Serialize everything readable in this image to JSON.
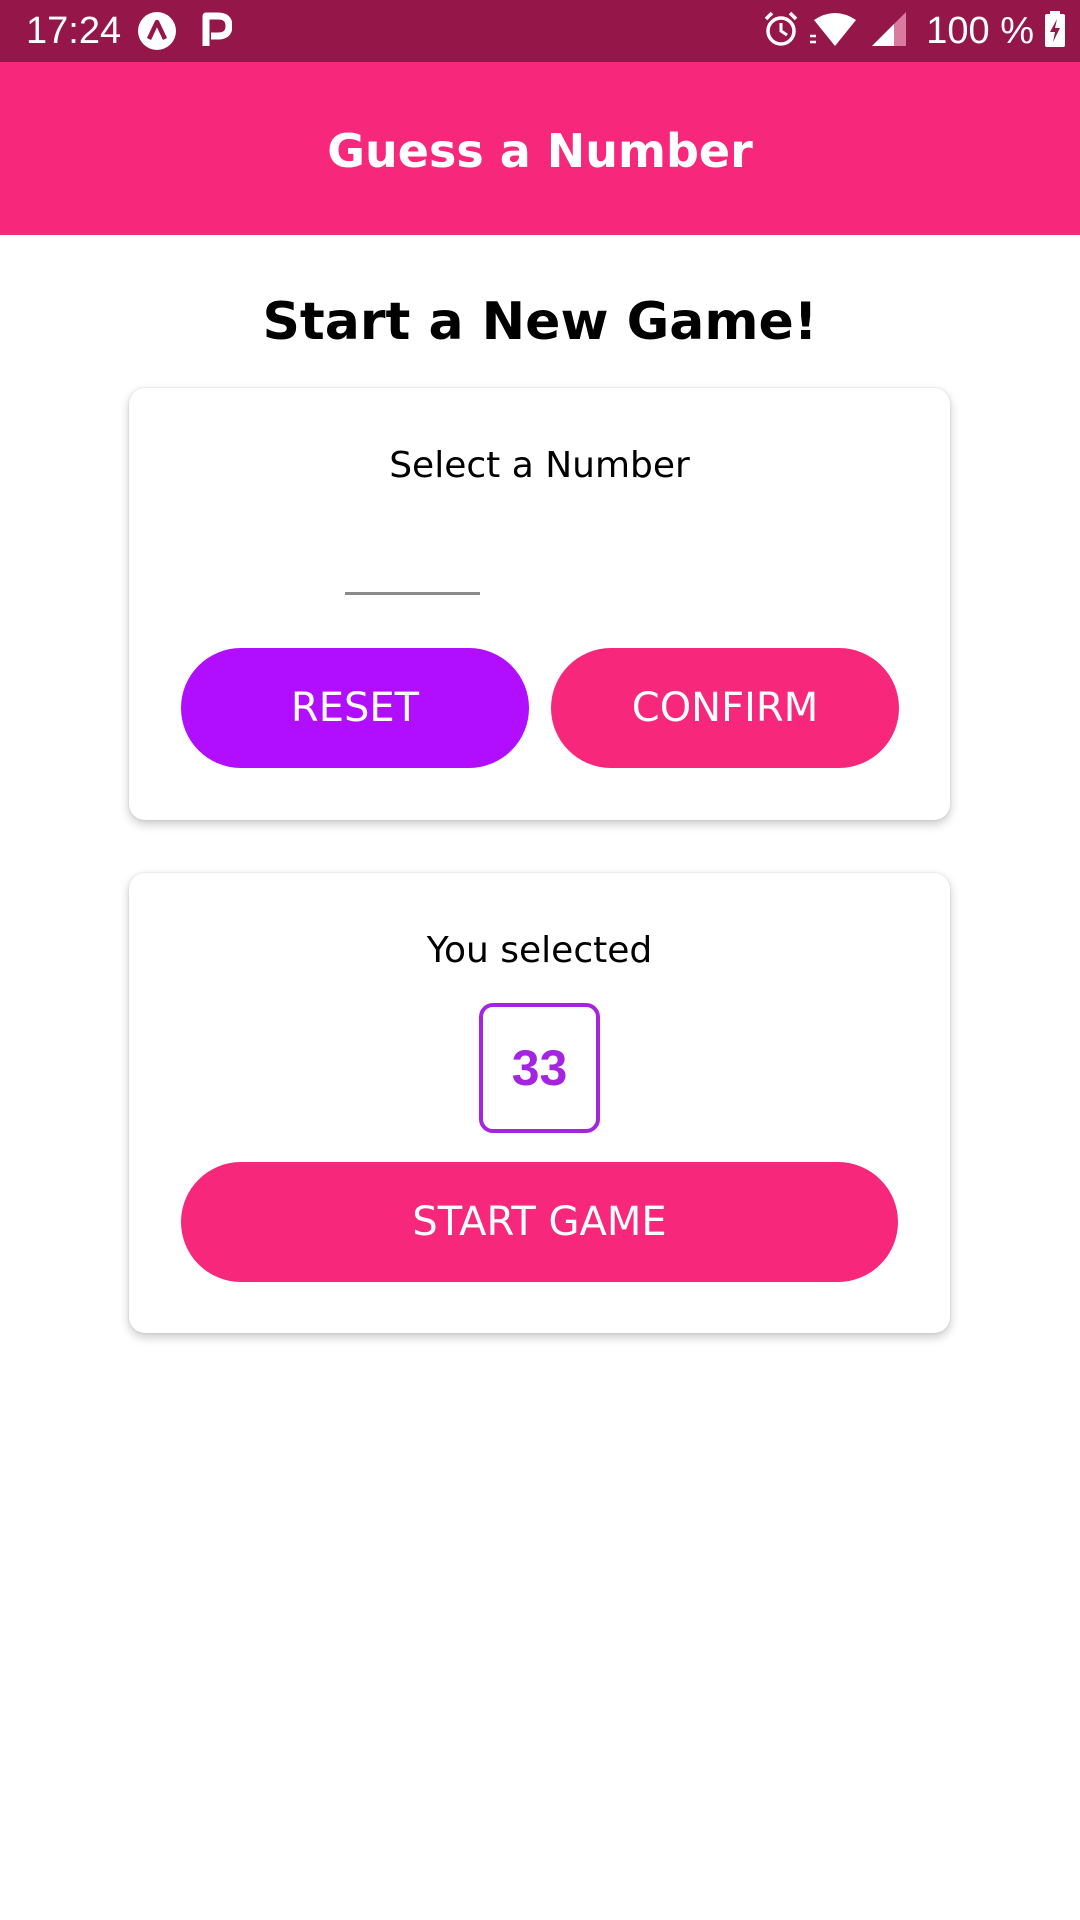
{
  "status_bar": {
    "time": "17:24",
    "battery_text": "100 %",
    "icons": [
      "app-a-icon",
      "p-icon",
      "alarm-icon",
      "wifi-icon",
      "signal-icon",
      "battery-charging-icon"
    ]
  },
  "header": {
    "title": "Guess a Number"
  },
  "screen": {
    "title": "Start a New Game!"
  },
  "input_card": {
    "label": "Select a Number",
    "input_value": "",
    "reset_label": "RESET",
    "confirm_label": "CONFIRM"
  },
  "summary_card": {
    "label": "You selected",
    "selected_number": "33",
    "start_label": "START GAME"
  },
  "colors": {
    "status_bar": "#95174a",
    "header": "#f7287b",
    "accent_purple": "#b10dff",
    "number_box": "#a424e0"
  }
}
